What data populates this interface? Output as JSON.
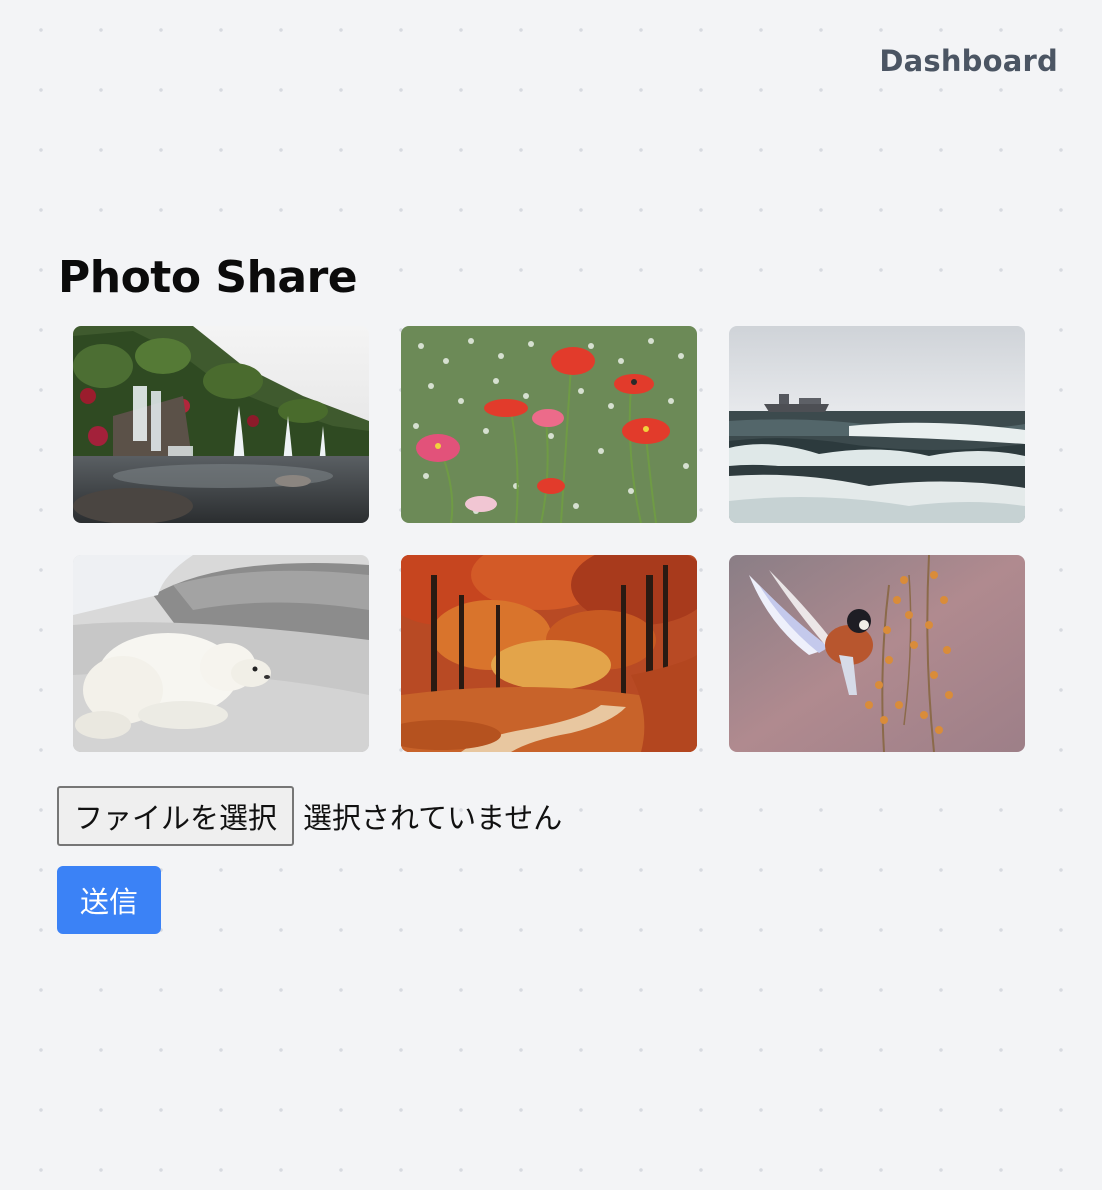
{
  "nav": {
    "dashboard_label": "Dashboard"
  },
  "page": {
    "title": "Photo Share"
  },
  "gallery": {
    "photos": [
      {
        "subject": "waterfall-garden"
      },
      {
        "subject": "poppy-flowers"
      },
      {
        "subject": "ship-ocean-waves"
      },
      {
        "subject": "polar-bear"
      },
      {
        "subject": "autumn-forest-path"
      },
      {
        "subject": "bird-in-flight"
      }
    ]
  },
  "upload": {
    "choose_file_label": "ファイルを選択",
    "status_text": "選択されていません",
    "submit_label": "送信"
  },
  "colors": {
    "background": "#f3f4f6",
    "accent": "#3b82f6",
    "nav_text": "#4b5563"
  }
}
